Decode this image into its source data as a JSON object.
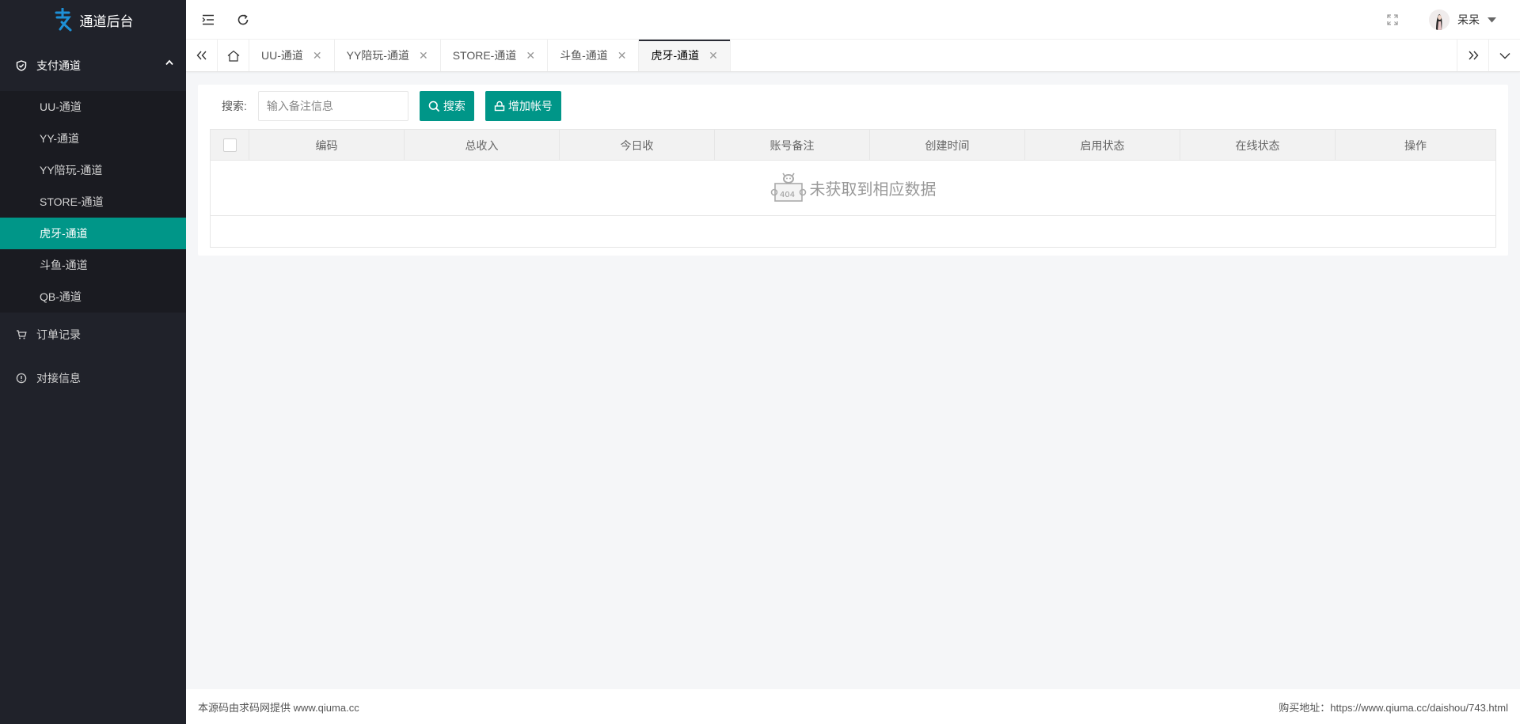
{
  "app": {
    "title": "通道后台"
  },
  "sidebar": {
    "group": {
      "label": "支付通道",
      "icon": "shield-icon"
    },
    "sub_items": [
      {
        "label": "UU-通道",
        "active": false
      },
      {
        "label": "YY-通道",
        "active": false
      },
      {
        "label": "YY陪玩-通道",
        "active": false
      },
      {
        "label": "STORE-通道",
        "active": false
      },
      {
        "label": "虎牙-通道",
        "active": true
      },
      {
        "label": "斗鱼-通道",
        "active": false
      },
      {
        "label": "QB-通道",
        "active": false
      }
    ],
    "items": [
      {
        "label": "订单记录",
        "icon": "cart-icon"
      },
      {
        "label": "对接信息",
        "icon": "info-icon"
      }
    ]
  },
  "header": {
    "user_name": "呆呆"
  },
  "tabs": [
    {
      "label": "UU-通道",
      "active": false
    },
    {
      "label": "YY陪玩-通道",
      "active": false
    },
    {
      "label": "STORE-通道",
      "active": false
    },
    {
      "label": "斗鱼-通道",
      "active": false
    },
    {
      "label": "虎牙-通道",
      "active": true
    }
  ],
  "search": {
    "label": "搜索:",
    "placeholder": "输入备注信息",
    "value": "",
    "search_button": "搜索",
    "add_button": "增加帐号"
  },
  "table": {
    "columns": [
      "编码",
      "总收入",
      "今日收",
      "账号备注",
      "创建时间",
      "启用状态",
      "在线状态",
      "操作"
    ],
    "rows": [],
    "empty_text": "未获取到相应数据"
  },
  "footer": {
    "left": "本源码由求码网提供 www.qiuma.cc",
    "right": "购买地址：https://www.qiuma.cc/daishou/743.html"
  },
  "colors": {
    "accent": "#009688",
    "sidebar_bg": "#20222a",
    "sidebar_sub_bg": "#1a1b21"
  }
}
